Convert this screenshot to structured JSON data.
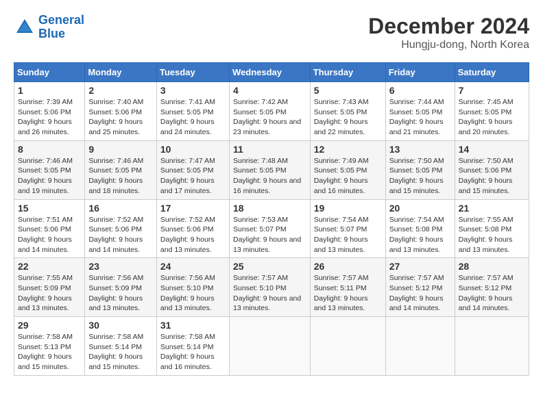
{
  "logo": {
    "line1": "General",
    "line2": "Blue"
  },
  "title": "December 2024",
  "subtitle": "Hungju-dong, North Korea",
  "days_of_week": [
    "Sunday",
    "Monday",
    "Tuesday",
    "Wednesday",
    "Thursday",
    "Friday",
    "Saturday"
  ],
  "weeks": [
    [
      {
        "day": "1",
        "sunrise": "7:39 AM",
        "sunset": "5:06 PM",
        "daylight": "9 hours and 26 minutes."
      },
      {
        "day": "2",
        "sunrise": "7:40 AM",
        "sunset": "5:06 PM",
        "daylight": "9 hours and 25 minutes."
      },
      {
        "day": "3",
        "sunrise": "7:41 AM",
        "sunset": "5:05 PM",
        "daylight": "9 hours and 24 minutes."
      },
      {
        "day": "4",
        "sunrise": "7:42 AM",
        "sunset": "5:05 PM",
        "daylight": "9 hours and 23 minutes."
      },
      {
        "day": "5",
        "sunrise": "7:43 AM",
        "sunset": "5:05 PM",
        "daylight": "9 hours and 22 minutes."
      },
      {
        "day": "6",
        "sunrise": "7:44 AM",
        "sunset": "5:05 PM",
        "daylight": "9 hours and 21 minutes."
      },
      {
        "day": "7",
        "sunrise": "7:45 AM",
        "sunset": "5:05 PM",
        "daylight": "9 hours and 20 minutes."
      }
    ],
    [
      {
        "day": "8",
        "sunrise": "7:46 AM",
        "sunset": "5:05 PM",
        "daylight": "9 hours and 19 minutes."
      },
      {
        "day": "9",
        "sunrise": "7:46 AM",
        "sunset": "5:05 PM",
        "daylight": "9 hours and 18 minutes."
      },
      {
        "day": "10",
        "sunrise": "7:47 AM",
        "sunset": "5:05 PM",
        "daylight": "9 hours and 17 minutes."
      },
      {
        "day": "11",
        "sunrise": "7:48 AM",
        "sunset": "5:05 PM",
        "daylight": "9 hours and 16 minutes."
      },
      {
        "day": "12",
        "sunrise": "7:49 AM",
        "sunset": "5:05 PM",
        "daylight": "9 hours and 16 minutes."
      },
      {
        "day": "13",
        "sunrise": "7:50 AM",
        "sunset": "5:05 PM",
        "daylight": "9 hours and 15 minutes."
      },
      {
        "day": "14",
        "sunrise": "7:50 AM",
        "sunset": "5:06 PM",
        "daylight": "9 hours and 15 minutes."
      }
    ],
    [
      {
        "day": "15",
        "sunrise": "7:51 AM",
        "sunset": "5:06 PM",
        "daylight": "9 hours and 14 minutes."
      },
      {
        "day": "16",
        "sunrise": "7:52 AM",
        "sunset": "5:06 PM",
        "daylight": "9 hours and 14 minutes."
      },
      {
        "day": "17",
        "sunrise": "7:52 AM",
        "sunset": "5:06 PM",
        "daylight": "9 hours and 13 minutes."
      },
      {
        "day": "18",
        "sunrise": "7:53 AM",
        "sunset": "5:07 PM",
        "daylight": "9 hours and 13 minutes."
      },
      {
        "day": "19",
        "sunrise": "7:54 AM",
        "sunset": "5:07 PM",
        "daylight": "9 hours and 13 minutes."
      },
      {
        "day": "20",
        "sunrise": "7:54 AM",
        "sunset": "5:08 PM",
        "daylight": "9 hours and 13 minutes."
      },
      {
        "day": "21",
        "sunrise": "7:55 AM",
        "sunset": "5:08 PM",
        "daylight": "9 hours and 13 minutes."
      }
    ],
    [
      {
        "day": "22",
        "sunrise": "7:55 AM",
        "sunset": "5:09 PM",
        "daylight": "9 hours and 13 minutes."
      },
      {
        "day": "23",
        "sunrise": "7:56 AM",
        "sunset": "5:09 PM",
        "daylight": "9 hours and 13 minutes."
      },
      {
        "day": "24",
        "sunrise": "7:56 AM",
        "sunset": "5:10 PM",
        "daylight": "9 hours and 13 minutes."
      },
      {
        "day": "25",
        "sunrise": "7:57 AM",
        "sunset": "5:10 PM",
        "daylight": "9 hours and 13 minutes."
      },
      {
        "day": "26",
        "sunrise": "7:57 AM",
        "sunset": "5:11 PM",
        "daylight": "9 hours and 13 minutes."
      },
      {
        "day": "27",
        "sunrise": "7:57 AM",
        "sunset": "5:12 PM",
        "daylight": "9 hours and 14 minutes."
      },
      {
        "day": "28",
        "sunrise": "7:57 AM",
        "sunset": "5:12 PM",
        "daylight": "9 hours and 14 minutes."
      }
    ],
    [
      {
        "day": "29",
        "sunrise": "7:58 AM",
        "sunset": "5:13 PM",
        "daylight": "9 hours and 15 minutes."
      },
      {
        "day": "30",
        "sunrise": "7:58 AM",
        "sunset": "5:14 PM",
        "daylight": "9 hours and 15 minutes."
      },
      {
        "day": "31",
        "sunrise": "7:58 AM",
        "sunset": "5:14 PM",
        "daylight": "9 hours and 16 minutes."
      },
      null,
      null,
      null,
      null
    ]
  ]
}
